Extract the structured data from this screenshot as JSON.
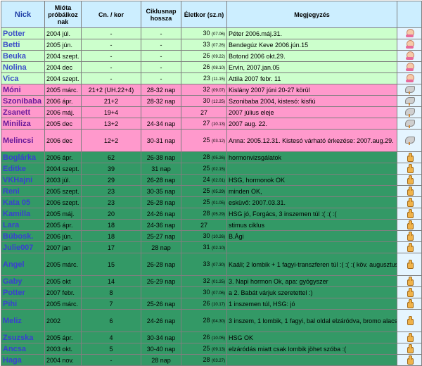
{
  "headers": {
    "nick": "Nick",
    "since": "Mióta próbálkoz nak",
    "cn": "Cn. / kor",
    "cycle": "Ciklusnap hossza",
    "age": "Életkor (sz.n)",
    "note": "Megjegyzés"
  },
  "rows": [
    {
      "nick": "Potter",
      "since": "2004 júl.",
      "cn": "-",
      "cycle": "-",
      "age": "30",
      "birth": "(07.06)",
      "note": "Péter 2006.máj.31.",
      "group": "green",
      "icon": "baby-icon"
    },
    {
      "nick": "Betti",
      "since": "2005 jún.",
      "cn": "-",
      "cycle": "-",
      "age": "33",
      "birth": "(07.26)",
      "note": "Bendegúz Keve 2006.jún.15",
      "group": "green",
      "icon": "baby-icon"
    },
    {
      "nick": "Beuka",
      "since": "2004 szept.",
      "cn": "-",
      "cycle": "-",
      "age": "26",
      "birth": "(09.22)",
      "note": "Botond 2006 okt.29.",
      "group": "green",
      "icon": "baby-icon"
    },
    {
      "nick": "Nolina",
      "since": "2004 dec",
      "cn": "-",
      "cycle": "-",
      "age": "26",
      "birth": "(08.10)",
      "note": "Ervin, 2007.jan.05",
      "group": "green",
      "icon": "baby-icon"
    },
    {
      "nick": "Vica",
      "since": "2004 szept.",
      "cn": "-",
      "cycle": "-",
      "age": "23",
      "birth": "(11.15)",
      "note": "Attila 2007 febr. 11",
      "group": "green",
      "icon": "baby-icon"
    },
    {
      "nick": "Móni",
      "since": "2005 márc.",
      "cn": "21+2 (UH.22+4)",
      "cycle": "28-32 nap",
      "age": "32",
      "birth": "(09.07)",
      "note": "Kislány 2007 júni 20-27 körül",
      "group": "pink",
      "icon": "stork-icon"
    },
    {
      "nick": "Szonibaba",
      "since": "2006 ápr.",
      "cn": "21+2",
      "cycle": "28-32 nap",
      "age": "30",
      "birth": "(12.25)",
      "note": "Szonibaba 2004, kistesó: kisfiú",
      "group": "pink",
      "icon": "stork-icon"
    },
    {
      "nick": "Zsanett",
      "since": "2006 máj.",
      "cn": "19+4",
      "cycle": "",
      "age": "27",
      "birth": "",
      "note": "2007 július eleje",
      "group": "pink",
      "icon": "stork-icon"
    },
    {
      "nick": "Miniliza",
      "since": "2005 dec",
      "cn": "13+2",
      "cycle": "24-34 nap",
      "age": "27",
      "birth": "(10.13)",
      "note": "2007 aug. 22.",
      "group": "pink",
      "icon": "stork-icon"
    },
    {
      "nick": "Melincsi",
      "since": "2006 dec",
      "cn": "12+2",
      "cycle": "30-31 nap",
      "age": "25",
      "birth": "(03.12)",
      "note": "Anna: 2005.12.31. Kistesó várható érkezése: 2007.aug.29.",
      "group": "pink",
      "icon": "stork-icon"
    },
    {
      "nick": "Boglárka",
      "since": "2006 ápr.",
      "cn": "62",
      "cycle": "26-38 nap",
      "age": "28",
      "birth": "(05.26)",
      "note": "hormonvizsgálatok",
      "group": "dark",
      "icon": "thumb-icon"
    },
    {
      "nick": "Editke",
      "since": "2004 szept.",
      "cn": "39",
      "cycle": "31 nap",
      "age": "25",
      "birth": "(02.15)",
      "note": "",
      "group": "dark",
      "icon": "thumb-icon"
    },
    {
      "nick": "VKHajni",
      "since": "2003 júl.",
      "cn": "29",
      "cycle": "26-28 nap",
      "age": "24",
      "birth": "(02.01)",
      "note": "HSG, hormonok OK",
      "group": "dark",
      "icon": "thumb-icon"
    },
    {
      "nick": "Reni",
      "since": "2005 szept.",
      "cn": "23",
      "cycle": "30-35 nap",
      "age": "25",
      "birth": "(05.29)",
      "note": "minden OK,",
      "group": "dark",
      "icon": "thumb-icon"
    },
    {
      "nick": "Kata 05",
      "since": "2006 szept.",
      "cn": "23",
      "cycle": "26-28 nap",
      "age": "25",
      "birth": "(01.05)",
      "note": "esküvő: 2007.03.31.",
      "group": "dark",
      "icon": "thumb-icon"
    },
    {
      "nick": "Kamilla",
      "since": "2005 máj.",
      "cn": "20",
      "cycle": "24-26 nap",
      "age": "28",
      "birth": "(05.29)",
      "note": "HSG jó, Forgács, 3 inszemen túl :( :( :(",
      "group": "dark",
      "icon": "thumb-icon"
    },
    {
      "nick": "Lara",
      "since": "2005 ápr.",
      "cn": "18",
      "cycle": "24-36 nap",
      "age": "27",
      "birth": "",
      "note": "stimus ciklus",
      "group": "dark",
      "icon": "thumb-icon"
    },
    {
      "nick": "Búbosk.",
      "since": "2006 jún.",
      "cn": "18",
      "cycle": "25-27 nap",
      "age": "30",
      "birth": "(10.26)",
      "note": "B.Ági",
      "group": "dark",
      "icon": "thumb-icon"
    },
    {
      "nick": "Julie007",
      "since": "2007 jan",
      "cn": "17",
      "cycle": "28 nap",
      "age": "31",
      "birth": "(02.10)",
      "note": "",
      "group": "dark",
      "icon": "thumb-icon"
    },
    {
      "nick": "Angel",
      "since": "2005 márc.",
      "cn": "15",
      "cycle": "26-28 nap",
      "age": "33",
      "birth": "(07.30)",
      "note": "Kaáli; 2 lombik + 1 fagyi-transzferen túl :( :( :( köv. augusztus",
      "group": "dark",
      "icon": "thumb-icon"
    },
    {
      "nick": "Gaby",
      "since": "2005 okt",
      "cn": "14",
      "cycle": "26-29 nap",
      "age": "32",
      "birth": "(01.25)",
      "note": "3. Napi hormon Ok, apa: gyógyszer",
      "group": "dark",
      "icon": "thumb-icon"
    },
    {
      "nick": "Potter",
      "since": "2007 febr.",
      "cn": "8",
      "cycle": "",
      "age": "30",
      "birth": "(07.06)",
      "note": "a 2. Babát várjuk szeretettel :)",
      "group": "dark",
      "icon": "thumb-icon"
    },
    {
      "nick": "Pihi",
      "since": "2005 márc.",
      "cn": "7",
      "cycle": "25-26 nap",
      "age": "26",
      "birth": "(10.17)",
      "note": "1 inszemen túl, HSG: jó",
      "group": "dark",
      "icon": "thumb-icon"
    },
    {
      "nick": "Meliz",
      "since": "2002",
      "cn": "6",
      "cycle": "24-26 nap",
      "age": "28",
      "birth": "(04.30)",
      "note": "3 inszem, 1 lombik, 1 fagyi, bal oldal elzáródva, bromo alacsony progira, köv. lombik: febr.",
      "group": "dark",
      "icon": "thumb-icon"
    },
    {
      "nick": "Zsuzska",
      "since": "2005 ápr.",
      "cn": "4",
      "cycle": "30-34 nap",
      "age": "26",
      "birth": "(10.05)",
      "note": "HSG OK",
      "group": "dark",
      "icon": "thumb-icon"
    },
    {
      "nick": "Ancsa",
      "since": "2003 okt.",
      "cn": "5",
      "cycle": "30-40 nap",
      "age": "25",
      "birth": "(09.13)",
      "note": "elzáródás miatt csak lombik jöhet szóba :(",
      "group": "dark",
      "icon": "thumb-icon"
    },
    {
      "nick": "Haga",
      "since": "2004 nov.",
      "cn": "-",
      "cycle": "28 nap",
      "age": "28",
      "birth": "(03.27)",
      "note": "",
      "group": "dark",
      "icon": "thumb-icon"
    }
  ]
}
